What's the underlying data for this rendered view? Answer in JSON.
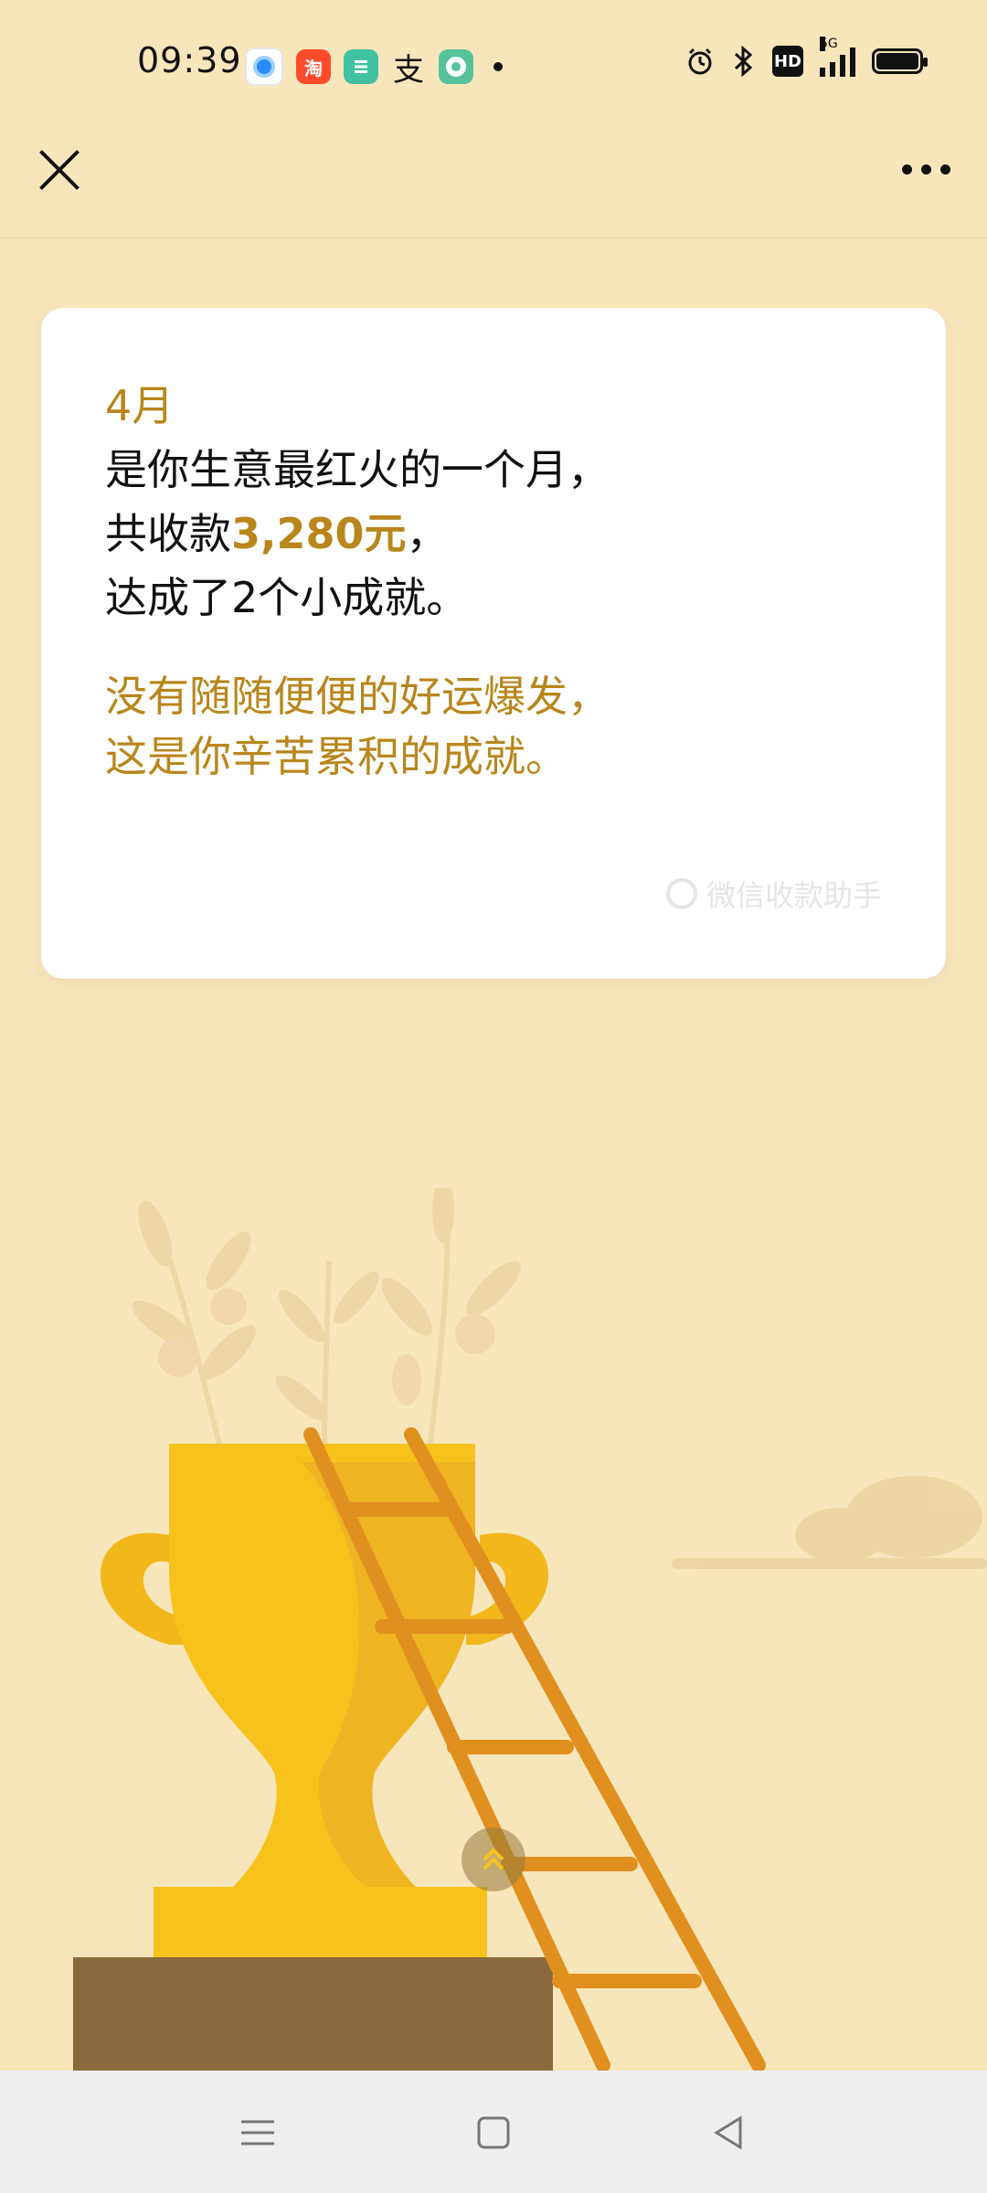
{
  "status_bar": {
    "time": "09:39",
    "notification_icons": [
      "browser-icon",
      "taobao-icon",
      "app-icon",
      "alipay-icon",
      "ring-app-icon"
    ],
    "right_icons": [
      "alarm-icon",
      "bluetooth-icon",
      "hd-icon",
      "5g-signal-icon",
      "battery-icon"
    ],
    "hd_label": "HD",
    "network_label": "5G",
    "taobao_glyph": "淘",
    "alipay_glyph": "支"
  },
  "top_nav": {
    "close_icon": "close-icon",
    "more_icon": "more-icon"
  },
  "card": {
    "month": "4月",
    "line1": "是你生意最红火的一个月，",
    "line2_prefix": "共收款",
    "amount": "3,280元",
    "line2_suffix": "，",
    "line3": "达成了2个小成就。",
    "quote_line1": "没有随随便便的好运爆发，",
    "quote_line2": "这是你辛苦累积的成就。",
    "watermark": "微信收款助手"
  },
  "illustration": {
    "description_icons": [
      "trophy-icon",
      "ladder-icon",
      "plant-icon",
      "cloud-icon"
    ]
  },
  "scroll_hint": {
    "icon": "double-chevron-up-icon"
  },
  "bottom_nav": {
    "items": [
      "menu-icon",
      "home-icon",
      "back-icon"
    ]
  },
  "colors": {
    "background": "#f8e6bb",
    "accent": "#b8861b",
    "trophy": "#f7c21b",
    "ladder": "#e0901f",
    "pedestal": "#8a6a3c"
  }
}
